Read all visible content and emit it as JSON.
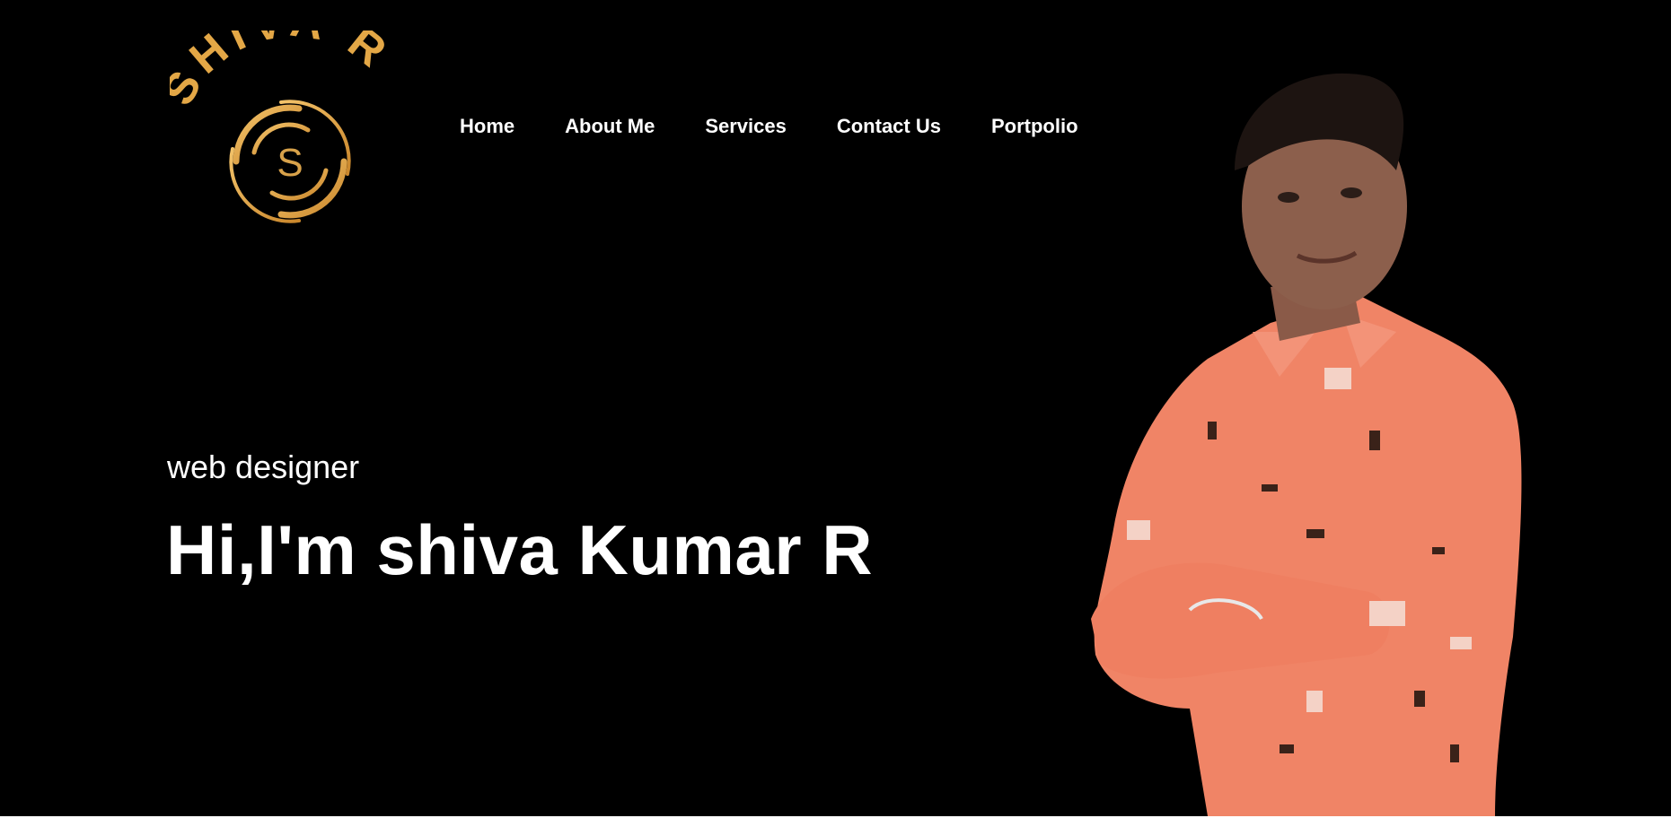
{
  "logo": {
    "text": "SHIVA R",
    "monogram": "S",
    "color": "#e3a746"
  },
  "nav": {
    "items": [
      {
        "label": "Home"
      },
      {
        "label": "About Me"
      },
      {
        "label": "Services"
      },
      {
        "label": "Contact Us"
      },
      {
        "label": "Portpolio"
      }
    ]
  },
  "hero": {
    "subtitle": "web designer",
    "headline": "Hi,I'm shiva Kumar R",
    "background": "#000000",
    "portrait": "person-photo-orange-shirt"
  }
}
